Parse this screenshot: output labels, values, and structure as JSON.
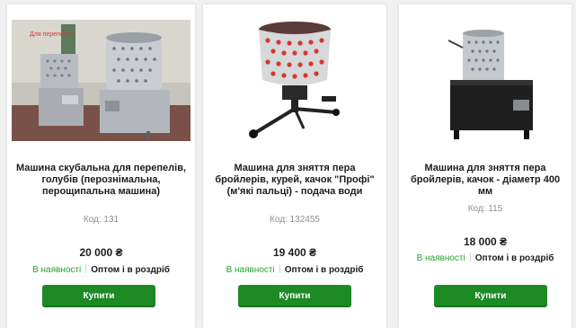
{
  "products": [
    {
      "photo_caption": "Для перепелов",
      "title": "Машина скубальна для перепелів, голубів (перознімальна, перощипальна машина)",
      "code": "Код: 131",
      "price": "20 000 ₴",
      "availability": "В наявності",
      "sale_type": "Оптом і в роздріб",
      "buy_label": "Купити"
    },
    {
      "title": "Машина для зняття пера бройлерів, курей, качок \"Профі\" (м'які пальці) - подача води",
      "code": "Код: 132455",
      "price": "19 400 ₴",
      "availability": "В наявності",
      "sale_type": "Оптом і в роздріб",
      "buy_label": "Купити"
    },
    {
      "title": "Машина для зняття пера бройлерів, качок - діаметр 400 мм",
      "code": "Код: 115",
      "price": "18 000 ₴",
      "availability": "В наявності",
      "sale_type": "Оптом і в роздріб",
      "buy_label": "Купити"
    }
  ],
  "colors": {
    "button": "#1d8a24",
    "in_stock": "#27a12f",
    "price": "#1d1d1d"
  }
}
